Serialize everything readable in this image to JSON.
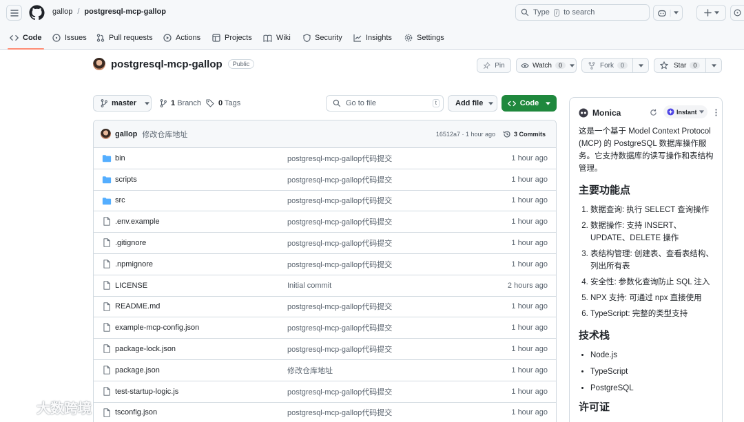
{
  "header": {
    "owner": "gallop",
    "repo": "postgresql-mcp-gallop",
    "search_prefix": "Type",
    "search_key": "/",
    "search_suffix": "to search"
  },
  "tabs": [
    {
      "label": "Code",
      "icon": "code-icon",
      "active": true
    },
    {
      "label": "Issues",
      "icon": "issue-icon"
    },
    {
      "label": "Pull requests",
      "icon": "pull-request-icon"
    },
    {
      "label": "Actions",
      "icon": "play-icon"
    },
    {
      "label": "Projects",
      "icon": "table-icon"
    },
    {
      "label": "Wiki",
      "icon": "book-icon"
    },
    {
      "label": "Security",
      "icon": "shield-icon"
    },
    {
      "label": "Insights",
      "icon": "graph-icon"
    },
    {
      "label": "Settings",
      "icon": "gear-icon"
    }
  ],
  "repo_head": {
    "name": "postgresql-mcp-gallop",
    "visibility": "Public",
    "pin_label": "Pin",
    "watch_label": "Watch",
    "watch_count": "0",
    "fork_label": "Fork",
    "fork_count": "0",
    "star_label": "Star",
    "star_count": "0"
  },
  "controls": {
    "branch": "master",
    "branch_count": "1",
    "branch_label": "Branch",
    "tag_count": "0",
    "tag_label": "Tags",
    "goto_placeholder": "Go to file",
    "goto_key": "t",
    "add_file": "Add file",
    "code": "Code"
  },
  "latest_commit": {
    "author": "gallop",
    "message": "修改仓库地址",
    "meta": "16512a7 · 1 hour ago",
    "commits": "3 Commits"
  },
  "files": [
    {
      "name": "bin",
      "type": "dir",
      "message": "postgresql-mcp-gallop代码提交",
      "age": "1 hour ago"
    },
    {
      "name": "scripts",
      "type": "dir",
      "message": "postgresql-mcp-gallop代码提交",
      "age": "1 hour ago"
    },
    {
      "name": "src",
      "type": "dir",
      "message": "postgresql-mcp-gallop代码提交",
      "age": "1 hour ago"
    },
    {
      "name": ".env.example",
      "type": "file",
      "message": "postgresql-mcp-gallop代码提交",
      "age": "1 hour ago"
    },
    {
      "name": ".gitignore",
      "type": "file",
      "message": "postgresql-mcp-gallop代码提交",
      "age": "1 hour ago"
    },
    {
      "name": ".npmignore",
      "type": "file",
      "message": "postgresql-mcp-gallop代码提交",
      "age": "1 hour ago"
    },
    {
      "name": "LICENSE",
      "type": "file",
      "message": "Initial commit",
      "age": "2 hours ago"
    },
    {
      "name": "README.md",
      "type": "file",
      "message": "postgresql-mcp-gallop代码提交",
      "age": "1 hour ago"
    },
    {
      "name": "example-mcp-config.json",
      "type": "file",
      "message": "postgresql-mcp-gallop代码提交",
      "age": "1 hour ago"
    },
    {
      "name": "package-lock.json",
      "type": "file",
      "message": "postgresql-mcp-gallop代码提交",
      "age": "1 hour ago"
    },
    {
      "name": "package.json",
      "type": "file",
      "message": "修改仓库地址",
      "age": "1 hour ago"
    },
    {
      "name": "test-startup-logic.js",
      "type": "file",
      "message": "postgresql-mcp-gallop代码提交",
      "age": "1 hour ago"
    },
    {
      "name": "tsconfig.json",
      "type": "file",
      "message": "postgresql-mcp-gallop代码提交",
      "age": "1 hour ago"
    }
  ],
  "monica": {
    "title": "Monica",
    "mode": "Instant",
    "intro": "这是一个基于 Model Context Protocol (MCP) 的 PostgreSQL 数据库操作服务。它支持数据库的读写操作和表结构管理。",
    "features_heading": "主要功能点",
    "features": [
      "数据查询: 执行 SELECT 查询操作",
      "数据操作: 支持 INSERT、UPDATE、DELETE 操作",
      "表结构管理: 创建表、查看表结构、列出所有表",
      "安全性: 参数化查询防止 SQL 注入",
      "NPX 支持: 可通过 npx 直接使用",
      "TypeScript: 完整的类型支持"
    ],
    "stack_heading": "技术栈",
    "stack": [
      "Node.js",
      "TypeScript",
      "PostgreSQL"
    ],
    "next_heading": "许可证"
  },
  "watermark": "大数跨境"
}
